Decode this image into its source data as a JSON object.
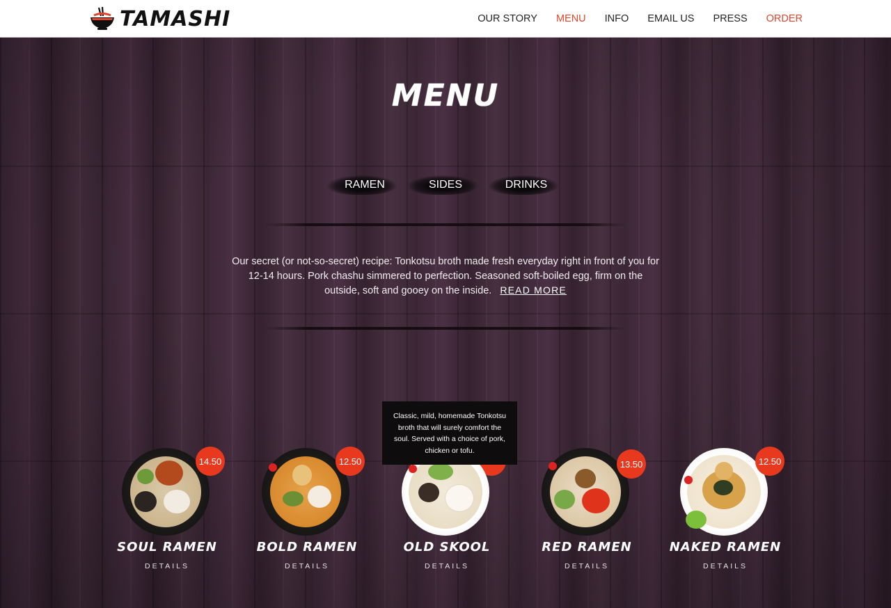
{
  "brand": {
    "name": "TAMASHI",
    "logo_icon": "ramen-bowl-icon"
  },
  "nav": [
    {
      "label": "OUR STORY",
      "active": false
    },
    {
      "label": "MENU",
      "active": true
    },
    {
      "label": "INFO",
      "active": false
    },
    {
      "label": "EMAIL US",
      "active": false
    },
    {
      "label": "PRESS",
      "active": false
    },
    {
      "label": "ORDER",
      "active": false,
      "accent": true
    }
  ],
  "colors": {
    "accent": "#e0452b",
    "price_badge": "#e8391f",
    "header_bg": "#ffffff",
    "wood": "#3e2a39"
  },
  "page": {
    "title": "MENU"
  },
  "tabs": [
    {
      "label": "RAMEN"
    },
    {
      "label": "SIDES"
    },
    {
      "label": "DRINKS"
    }
  ],
  "intro": {
    "text": "Our secret (or not-so-secret) recipe: Tonkotsu broth made fresh everyday right in front of you for 12-14 hours. Pork chashu simmered to perfection. Seasoned soft-boiled egg, firm on the outside, soft and gooey on the inside.",
    "read_more": "READ MORE"
  },
  "tooltip": {
    "text": "Classic, mild, homemade Tonkotsu broth that will surely comfort the soul. Served with a choice of pork, chicken or tofu."
  },
  "items": [
    {
      "name": "SOUL RAMEN",
      "price": "14.50",
      "details": "DETAILS"
    },
    {
      "name": "BOLD RAMEN",
      "price": "12.50",
      "details": "DETAILS"
    },
    {
      "name": "OLD SKOOL",
      "price": "",
      "details": "DETAILS"
    },
    {
      "name": "RED RAMEN",
      "price": "13.50",
      "details": "DETAILS"
    },
    {
      "name": "NAKED RAMEN",
      "price": "12.50",
      "details": "DETAILS"
    }
  ]
}
